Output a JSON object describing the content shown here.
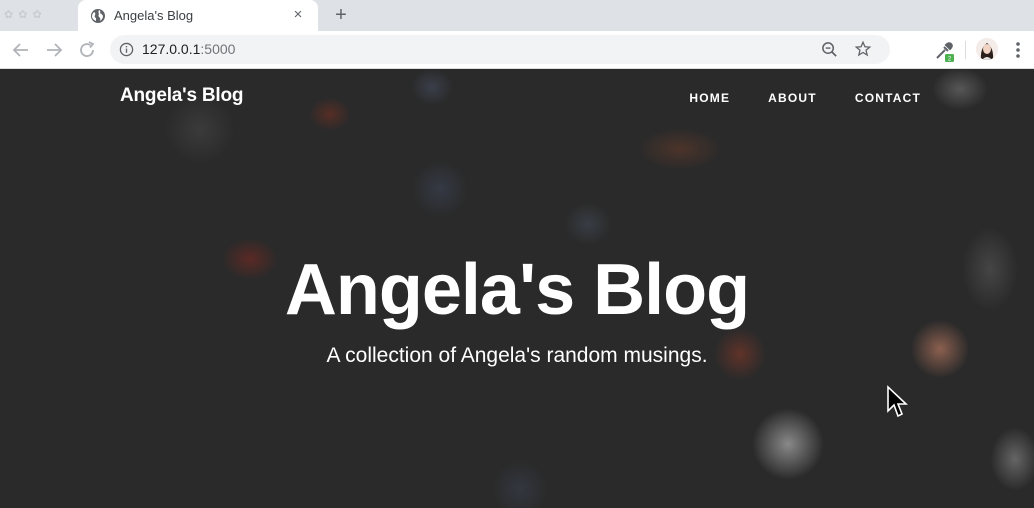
{
  "browser": {
    "ghost_tab_text": "✿ ✿ ✿",
    "tab_title": "Angela's Blog",
    "tab_close": "×",
    "new_tab": "+",
    "url_host": "127.0.0.1",
    "url_port": ":5000",
    "extension_badge": "2"
  },
  "site": {
    "brand": "Angela's Blog",
    "nav": [
      {
        "label": "HOME"
      },
      {
        "label": "ABOUT"
      },
      {
        "label": "CONTACT"
      }
    ],
    "hero": {
      "title": "Angela's Blog",
      "subtitle": "A collection of Angela's random musings."
    }
  },
  "colors": {
    "chrome_tabbar": "#dee1e6",
    "omnibox_bg": "#f1f3f4",
    "hero_overlay": "#2a2a2a",
    "text_white": "#ffffff",
    "extension_green": "#4caf50"
  },
  "icons": [
    "globe-icon",
    "close-icon",
    "plus-icon",
    "back-arrow-icon",
    "forward-arrow-icon",
    "reload-icon",
    "info-icon",
    "zoom-out-icon",
    "star-icon",
    "eyedropper-extension-icon",
    "avatar",
    "kebab-menu-icon",
    "mouse-cursor-icon"
  ]
}
